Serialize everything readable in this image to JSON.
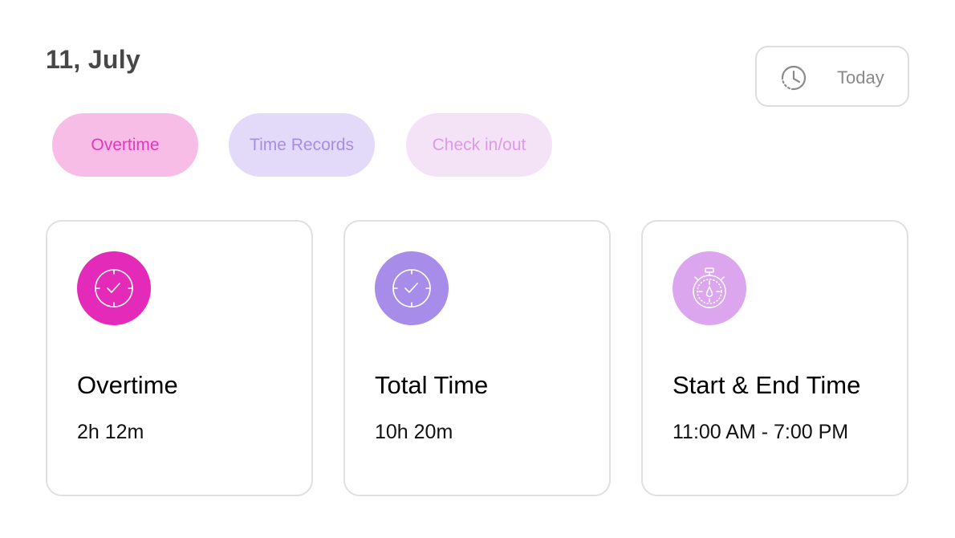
{
  "header": {
    "date": "11, July",
    "today_button": {
      "label": "Today",
      "icon": "clock-history-icon"
    }
  },
  "tabs": [
    {
      "label": "Overtime",
      "bg": "#f7bde6",
      "color": "#e23ab9"
    },
    {
      "label": "Time Records",
      "bg": "#e2daf8",
      "color": "#a78de4"
    },
    {
      "label": "Check in/out",
      "bg": "#f4e2f6",
      "color": "#dc9be6"
    }
  ],
  "cards": [
    {
      "title": "Overtime",
      "value": "2h 12m",
      "icon": "clock-check-icon",
      "color": "#e32ab9"
    },
    {
      "title": "Total Time",
      "value": "10h 20m",
      "icon": "clock-check-icon",
      "color": "#a78ce9"
    },
    {
      "title": "Start & End Time",
      "value": "11:00 AM - 7:00 PM",
      "icon": "stopwatch-icon",
      "color": "#dba6ee"
    }
  ]
}
